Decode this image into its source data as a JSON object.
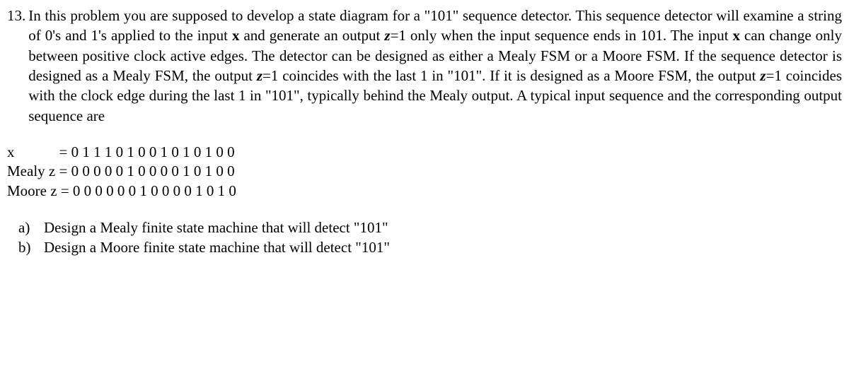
{
  "problem": {
    "number": "13.",
    "text_parts": {
      "p1": "In this problem you are supposed to develop a state diagram for a \"101\" sequence detector. This sequence detector will examine a string of 0's and 1's applied to the input ",
      "x1": "x",
      "p2": " and generate an output ",
      "z1": "z",
      "p3": "=1 only when the input sequence ends in 101. The input ",
      "x2": "x",
      "p4": " can change only between positive clock active edges. The detector can be designed as either a Mealy FSM or a Moore FSM. If the sequence detector is designed as a Mealy FSM, the output ",
      "z2": "z",
      "p5": "=1 coincides with the last 1 in \"101\". If it is designed as a Moore FSM, the output ",
      "z3": "z",
      "p6": "=1 coincides with the clock edge during the last 1 in \"101\", typically behind the Mealy output. A typical input sequence and the corresponding output sequence are"
    }
  },
  "sequences": {
    "x": {
      "label": "x",
      "eq": "= 0 1 1 1 0 1 0 0 1 0 1 0 1 0 0"
    },
    "mealy": {
      "label": "Mealy z ",
      "eq": "= 0 0 0 0 0 1 0 0 0 0 1 0 1 0 0"
    },
    "moore": {
      "label": "Moore z ",
      "eq": "= 0 0 0 0 0 0 1 0 0 0 0 1 0 1 0"
    }
  },
  "subparts": {
    "a": {
      "label": "a)",
      "text": "Design a Mealy finite state machine that will detect \"101\""
    },
    "b": {
      "label": "b)",
      "text": "Design a Moore finite state machine that will detect \"101\""
    }
  }
}
